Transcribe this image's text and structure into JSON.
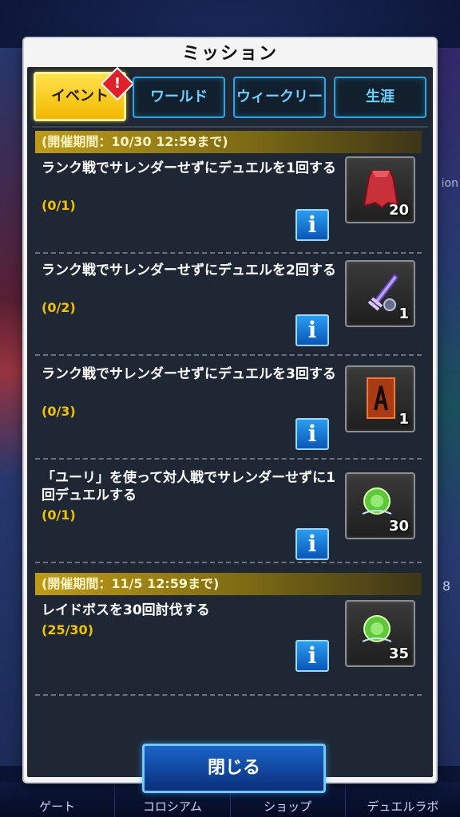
{
  "background": {
    "right_text": "ion",
    "right_number": "8"
  },
  "bottom_nav": {
    "items": [
      {
        "label": "ゲート"
      },
      {
        "label": "コロシアム"
      },
      {
        "label": "ショップ"
      },
      {
        "label": "デュエルラボ"
      }
    ]
  },
  "modal": {
    "title": "ミッション",
    "tabs": [
      {
        "label": "イベント",
        "active": true
      },
      {
        "label": "ワールド",
        "active": false
      },
      {
        "label": "ウィークリー",
        "active": false
      },
      {
        "label": "生涯",
        "active": false
      }
    ],
    "alert_badge": "!",
    "groups": [
      {
        "period": "(開催期間：10/30 12:59まで)",
        "missions": [
          {
            "text": "ランク戦でサレンダーせずにデュエルを1回する",
            "progress": "(0/1)",
            "reward_icon": "red-cape-icon",
            "reward_count": "20"
          },
          {
            "text": "ランク戦でサレンダーせずにデュエルを2回する",
            "progress": "(0/2)",
            "reward_icon": "sword-icon",
            "reward_count": "1"
          },
          {
            "text": "ランク戦でサレンダーせずにデュエルを3回する",
            "progress": "(0/3)",
            "reward_icon": "card-sleeve-icon",
            "reward_count": "1"
          },
          {
            "text": "「ユーリ」を使って対人戦でサレンダーせずに1回デュエルする",
            "progress": "(0/1)",
            "reward_icon": "ex-orb-icon",
            "reward_count": "30"
          }
        ]
      },
      {
        "period": "(開催期間：11/5 12:59まで)",
        "missions": [
          {
            "text": "レイドボスを30回討伐する",
            "progress": "(25/30)",
            "reward_icon": "ex-orb-icon",
            "reward_count": "35"
          }
        ]
      }
    ],
    "info_label": "i",
    "close_label": "閉じる"
  }
}
